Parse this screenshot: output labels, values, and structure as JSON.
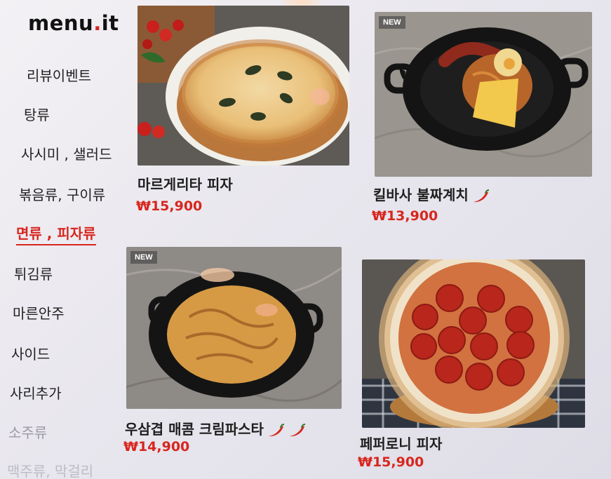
{
  "logo": {
    "main": "menu",
    "dot": ".",
    "suffix": "it"
  },
  "nav": [
    {
      "label": "리뷰이벤트"
    },
    {
      "label": "탕류"
    },
    {
      "label": "사시미 , 샐러드"
    },
    {
      "label": "볶음류, 구이류"
    },
    {
      "label": "면류 , 피자류",
      "active": true
    },
    {
      "label": "튀김류"
    },
    {
      "label": "마른안주"
    },
    {
      "label": "사이드"
    },
    {
      "label": "사리추가"
    },
    {
      "label": "소주류"
    },
    {
      "label": "맥주류, 막걸리"
    }
  ],
  "menu_items": [
    {
      "name": "마르게리타 피자",
      "price": "₩15,900",
      "badge": "",
      "spicy": 0,
      "image_icon": "margherita-pizza-image"
    },
    {
      "name": "킬바사 불짜계치",
      "price": "₩13,900",
      "badge": "NEW",
      "spicy": 1,
      "image_icon": "kielbasa-ramen-skillet-image"
    },
    {
      "name": "우삼겹 매콤 크림파스타",
      "price": "₩14,900",
      "badge": "NEW",
      "spicy": 2,
      "image_icon": "cream-pasta-skillet-image"
    },
    {
      "name": "페퍼로니 피자",
      "price": "₩15,900",
      "badge": "",
      "spicy": 0,
      "image_icon": "pepperoni-pizza-image"
    }
  ],
  "colors": {
    "accent": "#d7261e",
    "text": "#1b1b1b",
    "background": "#eceaf0"
  }
}
